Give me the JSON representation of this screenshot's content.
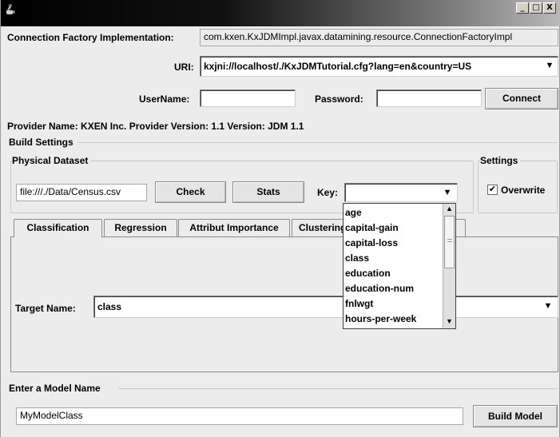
{
  "title_bar": {
    "icon": "java-coffee-cup-icon",
    "buttons": [
      "_",
      "□",
      "X"
    ]
  },
  "connection": {
    "factory_label": "Connection Factory Implementation:",
    "factory_value": "com.kxen.KxJDMImpl.javax.datamining.resource.ConnectionFactoryImpl",
    "uri_label": "URI:",
    "uri_value": "kxjni://localhost/./KxJDMTutorial.cfg?lang=en&country=US",
    "username_label": "UserName:",
    "username_value": "",
    "password_label": "Password:",
    "password_value": "",
    "connect_label": "Connect"
  },
  "provider_info": "Provider Name: KXEN Inc. Provider Version:  1.1 Version: JDM 1.1",
  "build_settings": {
    "title": "Build Settings",
    "physical_dataset": {
      "title": "Physical Dataset",
      "file_value": "file:///./Data/Census.csv",
      "check_label": "Check",
      "stats_label": "Stats",
      "key_label": "Key:",
      "key_value": ""
    },
    "settings": {
      "title": "Settings",
      "overwrite_label": "Overwrite",
      "overwrite_checked": true,
      "check_mark": "✔"
    }
  },
  "tabs": [
    "Classification",
    "Regression",
    "Attribut Importance",
    "Clustering"
  ],
  "key_dropdown": {
    "items": [
      "age",
      "capital-gain",
      "capital-loss",
      "class",
      "education",
      "education-num",
      "fnlwgt",
      "hours-per-week"
    ]
  },
  "classification": {
    "target_label": "Target Name:",
    "target_value": "class"
  },
  "model": {
    "title": "Enter a Model Name",
    "name_value": "MyModelClass",
    "build_label": "Build Model"
  }
}
